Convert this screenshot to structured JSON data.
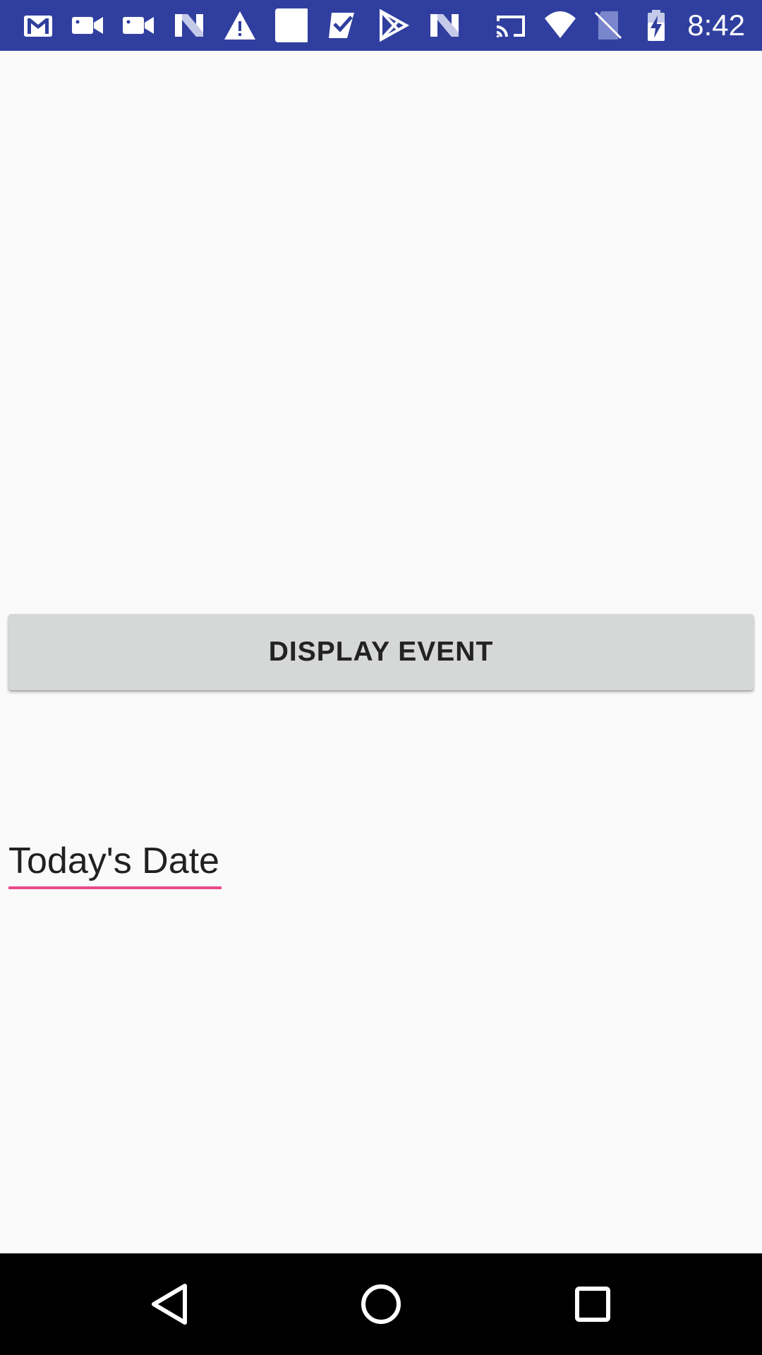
{
  "status_bar": {
    "color": "#303f9f",
    "time": "8:42",
    "notification_icons": [
      "gmail-icon",
      "video-camera-icon",
      "video-camera-icon",
      "n-app-icon",
      "warning-icon",
      "blank-square-icon",
      "checkmark-icon",
      "play-store-icon",
      "n-app-icon"
    ],
    "system_icons": [
      "cast-icon",
      "wifi-icon",
      "no-sim-icon",
      "battery-charging-icon"
    ]
  },
  "main": {
    "display_button_label": "DISPLAY EVENT",
    "date_field_text": "Today's Date",
    "accent_color": "#e94a8a"
  },
  "nav_bar": {
    "buttons": [
      "back-icon",
      "home-icon",
      "recents-icon"
    ]
  }
}
